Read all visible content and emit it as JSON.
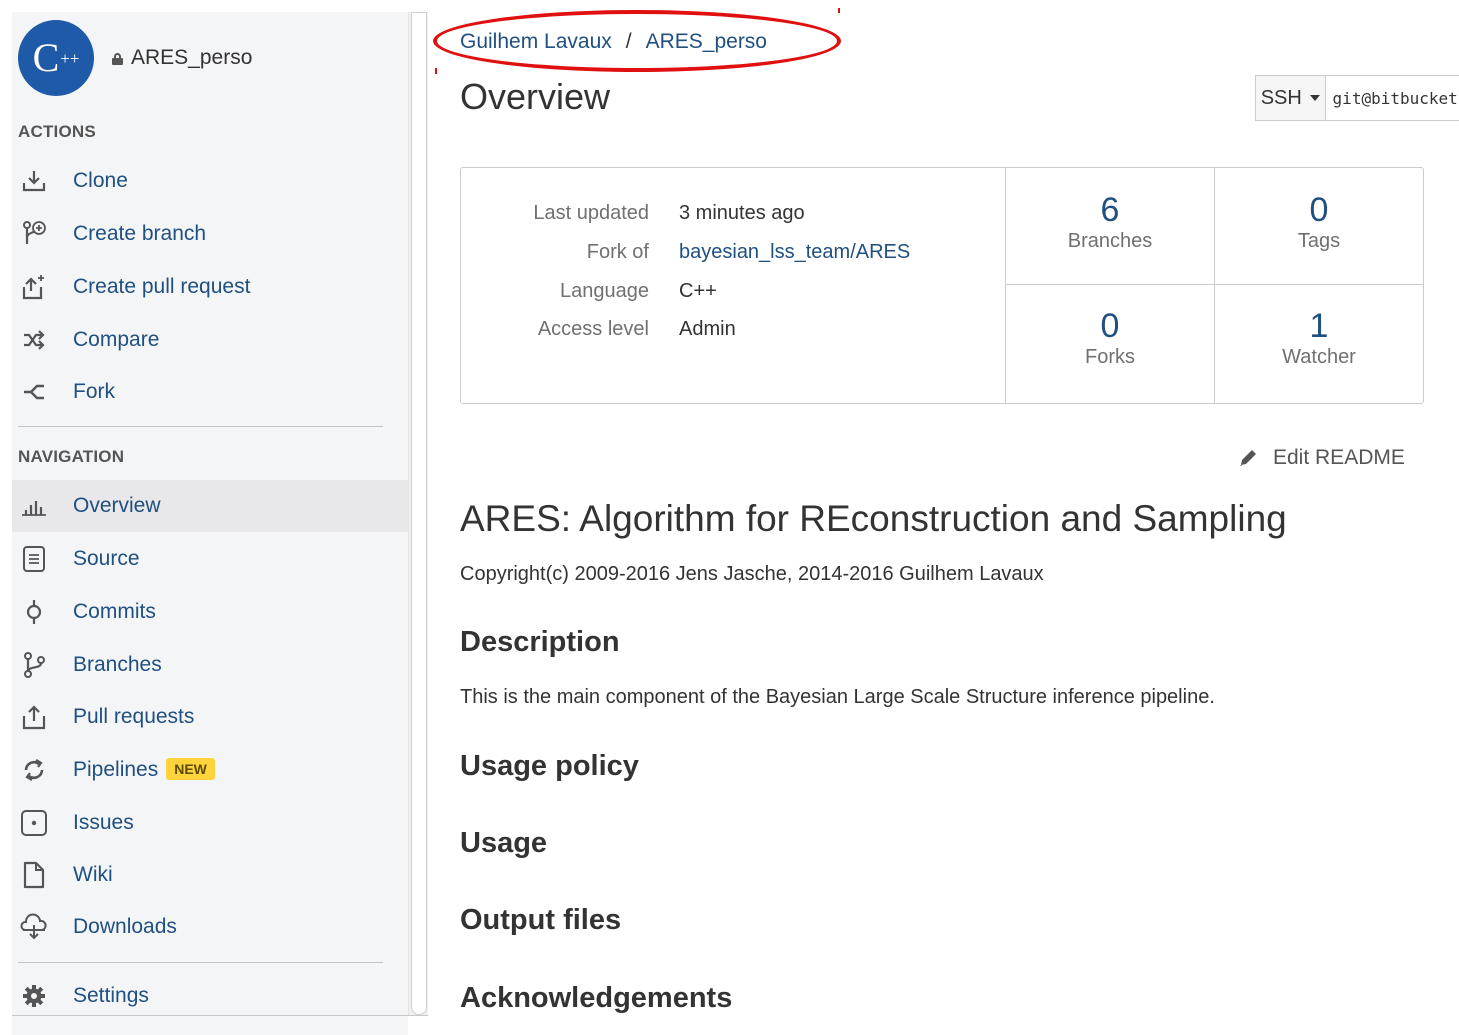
{
  "repo": {
    "avatar_text": "C",
    "avatar_suffix": "++",
    "name": "ARES_perso"
  },
  "actions": {
    "title": "ACTIONS",
    "items": [
      {
        "label": "Clone",
        "icon": "clone-icon"
      },
      {
        "label": "Create branch",
        "icon": "create-branch-icon"
      },
      {
        "label": "Create pull request",
        "icon": "create-pull-request-icon"
      },
      {
        "label": "Compare",
        "icon": "compare-icon"
      },
      {
        "label": "Fork",
        "icon": "fork-icon"
      }
    ]
  },
  "navigation": {
    "title": "NAVIGATION",
    "items": [
      {
        "label": "Overview",
        "icon": "overview-icon",
        "active": true
      },
      {
        "label": "Source",
        "icon": "source-icon"
      },
      {
        "label": "Commits",
        "icon": "commits-icon"
      },
      {
        "label": "Branches",
        "icon": "branches-icon"
      },
      {
        "label": "Pull requests",
        "icon": "pull-requests-icon"
      },
      {
        "label": "Pipelines",
        "icon": "pipelines-icon",
        "badge": "NEW"
      },
      {
        "label": "Issues",
        "icon": "issues-icon"
      },
      {
        "label": "Wiki",
        "icon": "wiki-icon"
      },
      {
        "label": "Downloads",
        "icon": "downloads-icon"
      }
    ]
  },
  "settings": {
    "label": "Settings",
    "icon": "gear-icon"
  },
  "breadcrumb": {
    "owner": "Guilhem Lavaux",
    "separator": "/",
    "repo": "ARES_perso"
  },
  "page_title": "Overview",
  "clone": {
    "protocol": "SSH",
    "url": "git@bitbucket.org:"
  },
  "info": {
    "last_updated_label": "Last updated",
    "last_updated_value": "3 minutes ago",
    "fork_of_label": "Fork of",
    "fork_of_value": "bayesian_lss_team/ARES",
    "language_label": "Language",
    "language_value": "C++",
    "access_label": "Access level",
    "access_value": "Admin"
  },
  "stats": {
    "branches": {
      "count": "6",
      "label": "Branches"
    },
    "tags": {
      "count": "0",
      "label": "Tags"
    },
    "forks": {
      "count": "0",
      "label": "Forks"
    },
    "watchers": {
      "count": "1",
      "label": "Watcher"
    }
  },
  "edit_readme": "Edit README",
  "readme": {
    "title": "ARES: Algorithm for REconstruction and Sampling",
    "copyright": "Copyright(c) 2009-2016 Jens Jasche, 2014-2016 Guilhem Lavaux",
    "description_heading": "Description",
    "description_text": "This is the main component of the Bayesian Large Scale Structure inference pipeline.",
    "usage_policy_heading": "Usage policy",
    "usage_heading": "Usage",
    "output_files_heading": "Output files",
    "acknowledgements_heading": "Acknowledgements"
  },
  "colors": {
    "link": "#205081",
    "avatar_bg": "#1e5aa8",
    "badge_bg": "#ffd33c",
    "highlight": "#e01010"
  }
}
